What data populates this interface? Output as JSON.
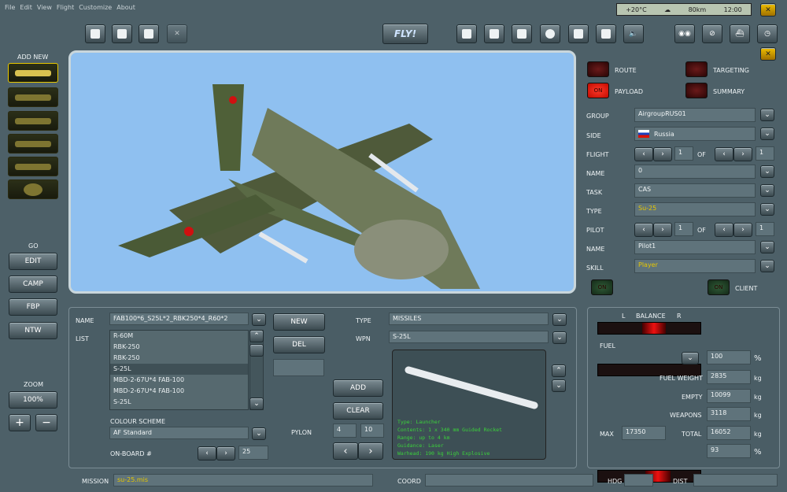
{
  "menu": [
    "File",
    "Edit",
    "View",
    "Flight",
    "Customize",
    "About"
  ],
  "weather": {
    "temp": "+20°C",
    "distance": "80km",
    "time": "12:00"
  },
  "toolbar": {
    "fly": "FLY!"
  },
  "add_new_label": "ADD NEW",
  "left": {
    "go": "GO",
    "buttons": [
      "EDIT",
      "CAMP",
      "FBP",
      "NTW"
    ],
    "zoom": "ZOOM",
    "zoom_value": "100%",
    "plus": "+",
    "minus": "−"
  },
  "tabs": {
    "route": "ROUTE",
    "targeting": "TARGETING",
    "payload": "PAYLOAD",
    "summary": "SUMMARY",
    "on": "ON"
  },
  "form": {
    "group_label": "GROUP",
    "group": "AirgroupRUS01",
    "side_label": "SIDE",
    "side": "Russia",
    "flight_label": "FLIGHT",
    "flight_num": "1",
    "of": "OF",
    "flight_total": "1",
    "name_label": "NAME",
    "name": "0",
    "task_label": "TASK",
    "task": "CAS",
    "type_label": "TYPE",
    "type": "Su-25",
    "pilot_label": "PILOT",
    "pilot_num": "1",
    "pilot_total": "1",
    "pname_label": "NAME",
    "pname": "Pilot1",
    "skill_label": "SKILL",
    "skill": "Player",
    "client": "CLIENT",
    "on": "ON"
  },
  "payload": {
    "name_label": "NAME",
    "name": "FAB100*6_S25L*2_RBK250*4_R60*2",
    "list_label": "LIST",
    "items": [
      "R-60M",
      "RBK-250",
      "RBK-250",
      "S-25L",
      "MBD-2-67U*4 FAB-100",
      "MBD-2-67U*4 FAB-100",
      "S-25L"
    ],
    "new": "NEW",
    "del": "DEL",
    "add": "ADD",
    "clear": "CLEAR",
    "type_label": "TYPE",
    "type": "MISSILES",
    "wpn_label": "WPN",
    "wpn": "S-25L",
    "colour_label": "COLOUR SCHEME",
    "colour": "AF Standard",
    "onboard_label": "ON-BOARD #",
    "onboard": "25",
    "pylon_label": "PYLON",
    "pylon1": "4",
    "pylon2": "10",
    "info": [
      "Type: Launcher",
      "Contents: 1 x 340 mm Guided Rocket",
      "Range: up to 4 km",
      "Guidance: Laser",
      "Warhead: 190 kg High Explosive"
    ]
  },
  "weights": {
    "balance": "BALANCE",
    "l": "L",
    "r": "R",
    "fuel_label": "FUEL",
    "fuel": "100",
    "pct": "%",
    "fuel_weight_label": "FUEL WEIGHT",
    "fuel_weight": "2835",
    "kg": "kg",
    "empty_label": "EMPTY",
    "empty": "10099",
    "weapons_label": "WEAPONS",
    "weapons": "3118",
    "max_label": "MAX",
    "max": "17350",
    "total_label": "TOTAL",
    "total": "16052",
    "load_pct": "93"
  },
  "status": {
    "mission_label": "MISSION",
    "mission": "su-25.mis",
    "coord_label": "COORD",
    "hdg_label": "HDG",
    "dist_label": "DIST"
  },
  "colors": {
    "sky": "#8fc0f0",
    "led_on": "#e81808",
    "info_text": "#3bd23b"
  }
}
